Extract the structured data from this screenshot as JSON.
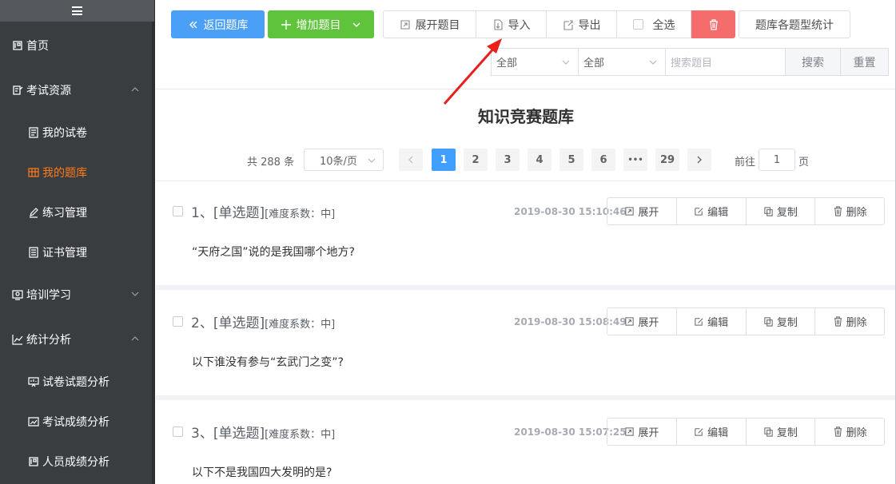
{
  "sidebar": {
    "items": [
      {
        "label": "首页",
        "icon": "home-icon",
        "level": 1
      },
      {
        "label": "考试资源",
        "icon": "exam-resource-icon",
        "level": 1,
        "expanded": true
      },
      {
        "label": "我的试卷",
        "icon": "paper-icon",
        "level": 2
      },
      {
        "label": "我的题库",
        "icon": "question-bank-icon",
        "level": 2,
        "active": true
      },
      {
        "label": "练习管理",
        "icon": "pen-icon",
        "level": 2
      },
      {
        "label": "证书管理",
        "icon": "certificate-icon",
        "level": 2
      },
      {
        "label": "培训学习",
        "icon": "training-icon",
        "level": 1,
        "expanded": false
      },
      {
        "label": "统计分析",
        "icon": "chart-icon",
        "level": 1,
        "expanded": true
      },
      {
        "label": "试卷试题分析",
        "icon": "analysis-icon",
        "level": 2
      },
      {
        "label": "考试成绩分析",
        "icon": "score-icon",
        "level": 2
      },
      {
        "label": "人员成绩分析",
        "icon": "person-score-icon",
        "level": 2
      }
    ],
    "active_color": "#ff7a1a"
  },
  "toolbar": {
    "back_label": "返回题库",
    "add_label": "增加题目",
    "expand_label": "展开题目",
    "import_label": "导入",
    "export_label": "导出",
    "select_all_label": "全选",
    "stats_label": "题库各题型统计",
    "filter1_value": "全部",
    "filter2_value": "全部",
    "search_placeholder": "搜索题目",
    "search_label": "搜索",
    "reset_label": "重置"
  },
  "page_title": "知识竞赛题库",
  "pagination": {
    "total": "共 288 条",
    "page_size": "10条/页",
    "pages": [
      "1",
      "2",
      "3",
      "4",
      "5",
      "6",
      "•••",
      "29"
    ],
    "current": "1",
    "goto_prefix": "前往",
    "goto_value": "1",
    "goto_suffix": "页"
  },
  "questions": [
    {
      "title": "1、[单选题]",
      "meta": "[难度系数：中]",
      "time": "2019-08-30 15:10:46",
      "text": "“天府之国”说的是我国哪个地方?"
    },
    {
      "title": "2、[单选题]",
      "meta": "[难度系数：中]",
      "time": "2019-08-30 15:08:49",
      "text": "以下谁没有参与“玄武门之变”?"
    },
    {
      "title": "3、[单选题]",
      "meta": "[难度系数：中]",
      "time": "2019-08-30 15:07:25",
      "text": "以下不是我国四大发明的是?"
    }
  ],
  "question_actions": {
    "expand": "展开",
    "edit": "编辑",
    "copy": "复制",
    "delete": "删除"
  },
  "colors": {
    "primary": "#4aa0f7",
    "success": "#5fc43c",
    "danger": "#f56c6c",
    "annotation": "#e8201b"
  }
}
